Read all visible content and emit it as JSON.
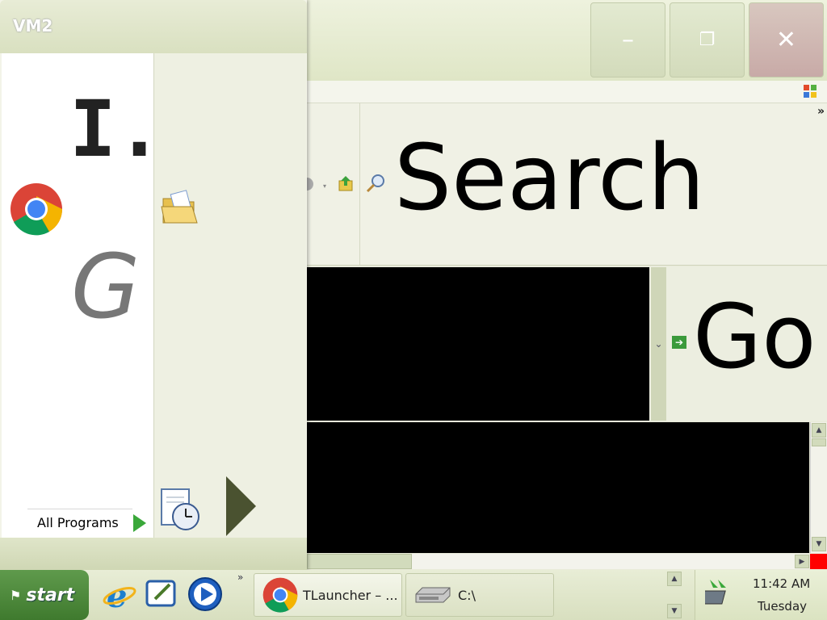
{
  "window": {
    "title": "",
    "min_glyph": "–",
    "max_glyph": "❐",
    "close_glyph": "✕",
    "search_label": "Search",
    "go_label": "Go",
    "address_dropdown_glyph": "⌄",
    "chevron": "»"
  },
  "start_menu": {
    "user_name": "VM2",
    "pinned_ie_label": "I.",
    "pinned_g_label": "G",
    "all_programs_label": "All Programs"
  },
  "taskbar": {
    "start_label": "start",
    "quick_launch_chevron": "»",
    "tasks": [
      {
        "label": "TLauncher – ..."
      },
      {
        "label": "C:\\"
      }
    ],
    "clock_time": "11:42 AM",
    "clock_day": "Tuesday"
  },
  "colors": {
    "start_green": "#3f7a2e",
    "close_red": "#c8aaa7",
    "accent_go": "#3b9a3b"
  }
}
